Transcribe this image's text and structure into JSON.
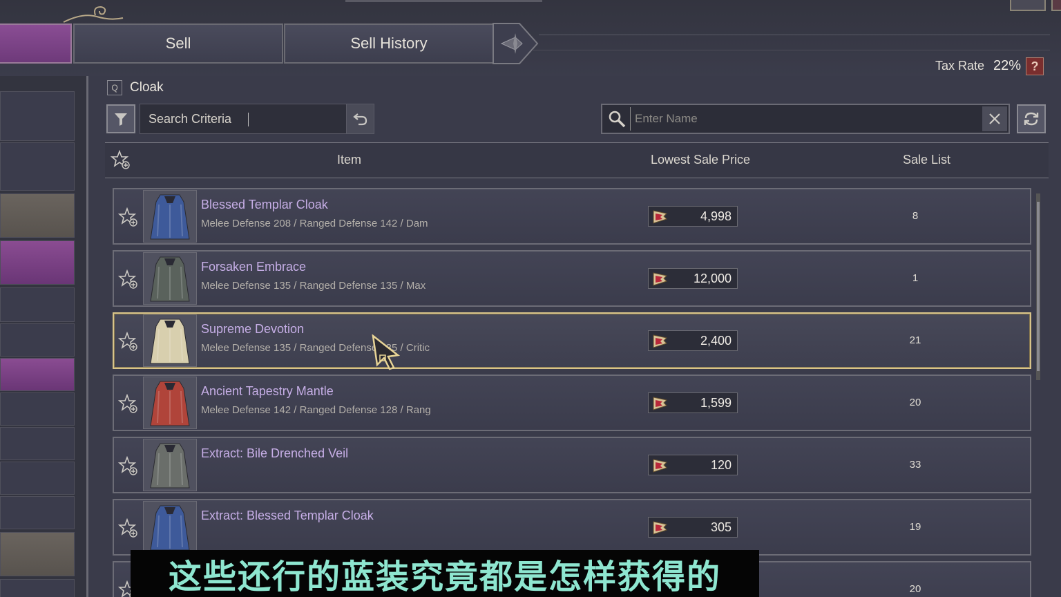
{
  "tabs": {
    "sell_label": "Sell",
    "history_label": "Sell History"
  },
  "header": {
    "category_icon": "Q",
    "category": "Cloak",
    "tax_label": "Tax Rate",
    "tax_value": "22%",
    "tax_help": "?"
  },
  "filter": {
    "criteria_label": "Search Criteria"
  },
  "search": {
    "placeholder": "Enter Name"
  },
  "table": {
    "columns": {
      "item": "Item",
      "price": "Lowest Sale Price",
      "list": "Sale List"
    },
    "rows": [
      {
        "name": "Blessed Templar Cloak",
        "stats": "Melee Defense 208 / Ranged Defense 142 / Dam",
        "price": "4,998",
        "count": "8",
        "cloak_color": "#3e5a9a"
      },
      {
        "name": "Forsaken Embrace",
        "stats": "Melee Defense 135 / Ranged Defense 135 / Max",
        "price": "12,000",
        "count": "1",
        "cloak_color": "#5a625c"
      },
      {
        "name": "Supreme Devotion",
        "stats": "Melee Defense 135 / Ranged Defense 135 / Critic",
        "price": "2,400",
        "count": "21",
        "cloak_color": "#d8cfae"
      },
      {
        "name": "Ancient Tapestry Mantle",
        "stats": "Melee Defense 142 / Ranged Defense 128 / Rang",
        "price": "1,599",
        "count": "20",
        "cloak_color": "#b0443a"
      },
      {
        "name": "Extract: Bile Drenched Veil",
        "stats": "",
        "price": "120",
        "count": "33",
        "cloak_color": "#6a6e6a"
      },
      {
        "name": "Extract: Blessed Templar Cloak",
        "stats": "",
        "price": "305",
        "count": "19",
        "cloak_color": "#3e5a9a"
      },
      {
        "name": "",
        "stats": "",
        "price": "",
        "count": "20",
        "cloak_color": "#555"
      }
    ]
  },
  "subtitle": "这些还行的蓝装究竟都是怎样获得的",
  "colors": {
    "accent_purple": "#8a4d94",
    "item_name": "#c6aee6",
    "selected_border": "#d8c48a",
    "subtitle_text": "#8ee6d0"
  }
}
